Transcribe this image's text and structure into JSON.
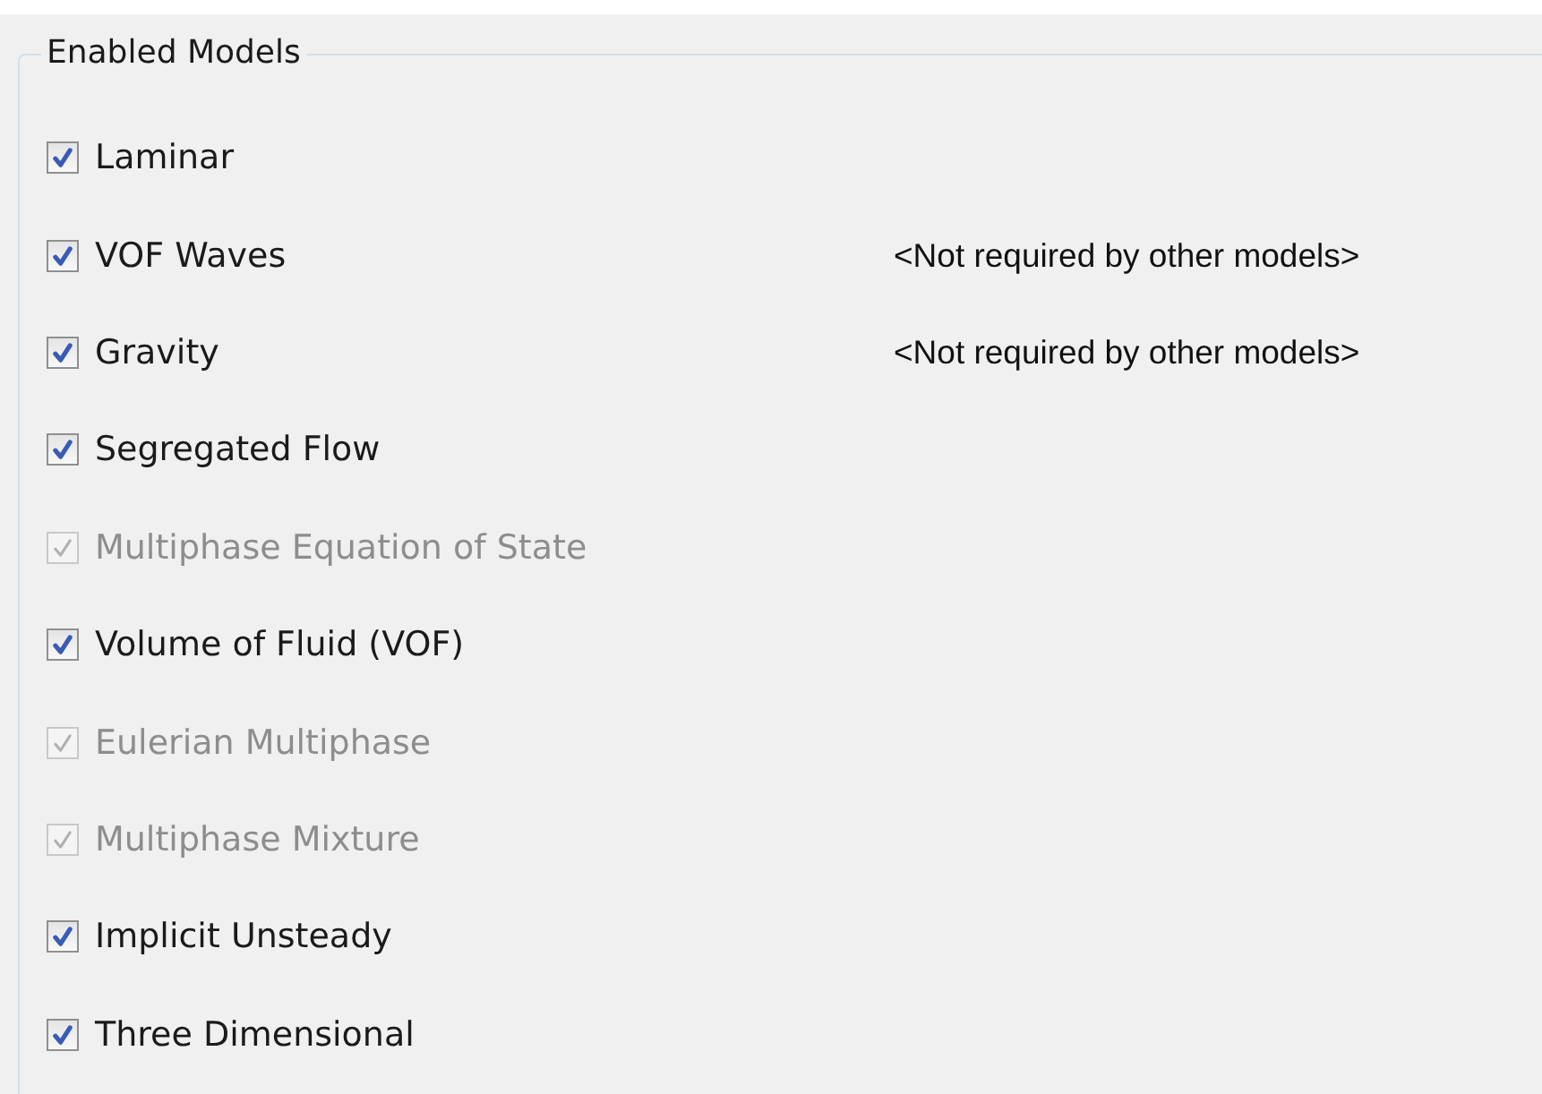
{
  "group": {
    "title": "Enabled Models"
  },
  "models": [
    {
      "label": "Laminar",
      "checked": true,
      "disabled": false
    },
    {
      "label": "VOF Waves",
      "checked": true,
      "disabled": false,
      "note": "<Not required by other models>"
    },
    {
      "label": "Gravity",
      "checked": true,
      "disabled": false,
      "note": "<Not required by other models>"
    },
    {
      "label": "Segregated Flow",
      "checked": true,
      "disabled": false
    },
    {
      "label": "Multiphase Equation of State",
      "checked": true,
      "disabled": true
    },
    {
      "label": "Volume of Fluid (VOF)",
      "checked": true,
      "disabled": false
    },
    {
      "label": "Eulerian Multiphase",
      "checked": true,
      "disabled": true
    },
    {
      "label": "Multiphase Mixture",
      "checked": true,
      "disabled": true
    },
    {
      "label": "Implicit Unsteady",
      "checked": true,
      "disabled": false
    },
    {
      "label": "Three Dimensional",
      "checked": true,
      "disabled": false
    }
  ]
}
